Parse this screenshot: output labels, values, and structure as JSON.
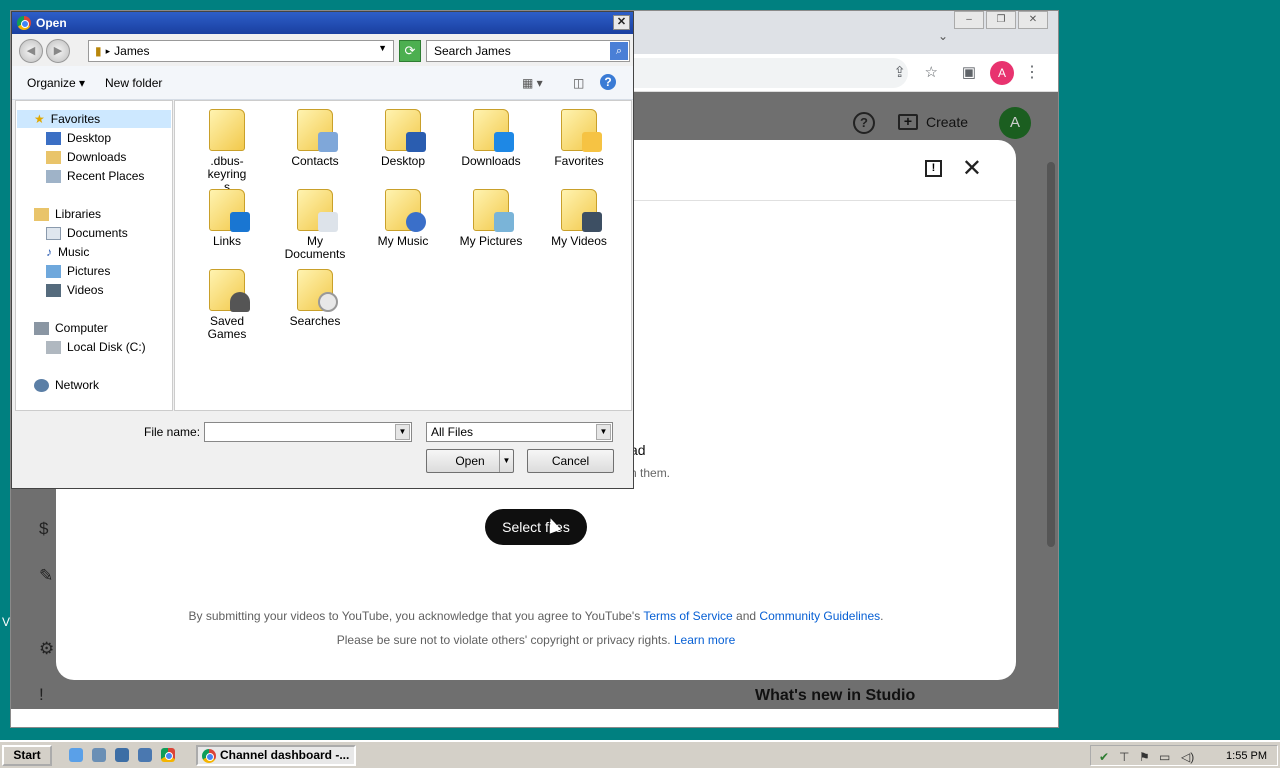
{
  "browser": {
    "tab_chevron": "⌄",
    "window_buttons": [
      "–",
      "❐",
      "✕"
    ],
    "profile_letter": "A",
    "icons": [
      "share-icon",
      "star-icon",
      "sidepanel-icon",
      "menu-icon"
    ]
  },
  "studio": {
    "help_label": "?",
    "create_label": "Create",
    "avatar_letter": "A",
    "whats_new": "What's new in Studio",
    "side_label_partial": "V",
    "modal": {
      "title_fragment": "ad",
      "subtitle_fragment": "n them.",
      "select_button": "Select files",
      "terms_prefix": "By submitting your videos to YouTube, you acknowledge that you agree to YouTube's ",
      "terms_link": "Terms of Service",
      "terms_and": " and ",
      "guidelines_link": "Community Guidelines",
      "terms_suffix": ".",
      "privacy_prefix": "Please be sure not to violate others' copyright or privacy rights. ",
      "learn_more": "Learn more"
    }
  },
  "dialog": {
    "title": "Open",
    "address": "James",
    "search_placeholder": "Search James",
    "organize_label": "Organize",
    "new_folder_label": "New folder",
    "nav": {
      "favorites": "Favorites",
      "desktop": "Desktop",
      "downloads": "Downloads",
      "recent_places": "Recent Places",
      "libraries": "Libraries",
      "documents": "Documents",
      "music": "Music",
      "pictures": "Pictures",
      "videos": "Videos",
      "computer": "Computer",
      "local_disk": "Local Disk (C:)",
      "network": "Network"
    },
    "files": [
      {
        "name": ".dbus-keyring\ns",
        "icon": "folder-icon"
      },
      {
        "name": "Contacts",
        "icon": "contacts-folder-icon"
      },
      {
        "name": "Desktop",
        "icon": "desktop-folder-icon"
      },
      {
        "name": "Downloads",
        "icon": "downloads-folder-icon"
      },
      {
        "name": "Favorites",
        "icon": "favorites-folder-icon"
      },
      {
        "name": "Links",
        "icon": "links-folder-icon"
      },
      {
        "name": "My\nDocuments",
        "icon": "documents-folder-icon"
      },
      {
        "name": "My Music",
        "icon": "music-folder-icon"
      },
      {
        "name": "My Pictures",
        "icon": "pictures-folder-icon"
      },
      {
        "name": "My Videos",
        "icon": "videos-folder-icon"
      },
      {
        "name": "Saved\nGames",
        "icon": "saved-games-folder-icon"
      },
      {
        "name": "Searches",
        "icon": "searches-folder-icon"
      }
    ],
    "file_name_label": "File name:",
    "file_name_value": "",
    "file_type": "All Files",
    "open_button": "Open",
    "cancel_button": "Cancel"
  },
  "taskbar": {
    "start_label": "Start",
    "task_label": "Channel dashboard -...",
    "clock": "1:55 PM"
  },
  "colors": {
    "desktop": "#008080",
    "titlebar": "#1a3fa0",
    "link": "#065fd4",
    "select_button": "#0f0f0f"
  }
}
